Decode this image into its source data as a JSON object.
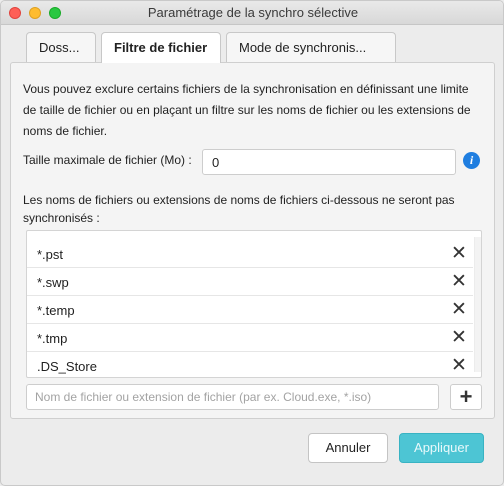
{
  "window": {
    "title": "Paramétrage de la synchro sélective"
  },
  "tabs": [
    {
      "label": "Doss...",
      "active": false
    },
    {
      "label": "Filtre de fichier",
      "active": true
    },
    {
      "label": "Mode de synchronis...",
      "active": false
    }
  ],
  "description": "Vous pouvez exclure certains fichiers de la synchronisation en définissant une limite de taille de fichier ou en plaçant un filtre sur les noms de fichier ou les extensions de noms de fichier.",
  "max_size": {
    "label": "Taille maximale de fichier (Mo) :",
    "value": "0",
    "info_icon": "info-icon"
  },
  "excluded": {
    "label": "Les noms de fichiers ou extensions de noms de fichiers ci-dessous ne seront pas synchronisés :",
    "items": [
      "*.pst",
      "*.swp",
      "*.temp",
      "*.tmp",
      ".DS_Store"
    ],
    "delete_glyph": "✕"
  },
  "new_filter": {
    "placeholder": "Nom de fichier ou extension de fichier (par ex. Cloud.exe, *.iso)",
    "add_glyph": "+"
  },
  "buttons": {
    "cancel": "Annuler",
    "apply": "Appliquer"
  },
  "colors": {
    "accent": "#4dc5d4",
    "info": "#1f7ee0"
  }
}
